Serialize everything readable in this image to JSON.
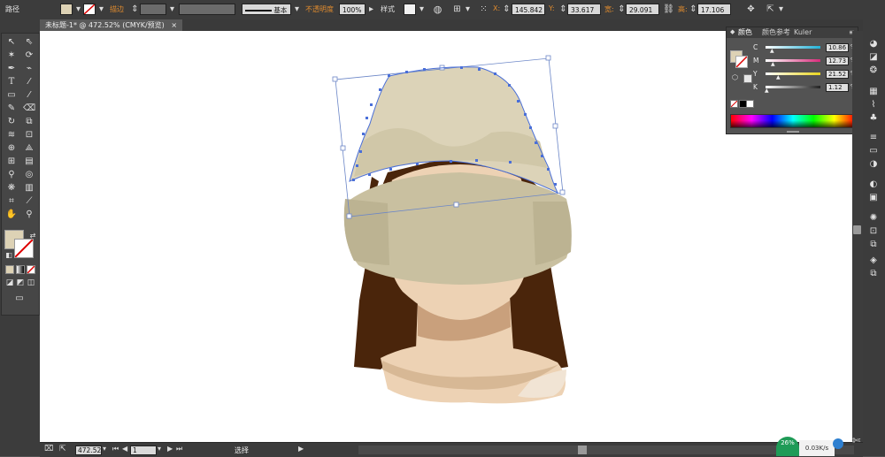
{
  "control_bar": {
    "object_type": "路径",
    "stroke_label": "描边",
    "stroke_profile": "基本",
    "opacity_label": "不透明度",
    "opacity_value": "100%",
    "style_label": "样式",
    "x_label": "X:",
    "x_value": "145.842",
    "y_label": "Y:",
    "y_value": "33.617",
    "w_label": "宽:",
    "w_value": "29.091",
    "h_label": "高:",
    "h_value": "17.106",
    "fill_color": "#ddd2b5"
  },
  "document_tab": {
    "title": "未标题-1* @ 472.52% (CMYK/预览)",
    "close": "×"
  },
  "color_panel": {
    "tabs": [
      "颜色",
      "颜色参考",
      "Kuler"
    ],
    "sliders": [
      {
        "channel": "C",
        "value": "10.86",
        "unit": "%",
        "level": 0.11,
        "color": "#22b1d7"
      },
      {
        "channel": "M",
        "value": "12.73",
        "unit": "%",
        "level": 0.13,
        "color": "#d82b7a"
      },
      {
        "channel": "Y",
        "value": "21.52",
        "unit": "%",
        "level": 0.22,
        "color": "#e9d51f"
      },
      {
        "channel": "K",
        "value": "1.12",
        "unit": "%",
        "level": 0.01,
        "color": "#222222"
      }
    ]
  },
  "status_bar": {
    "zoom": "472.52",
    "page": "1",
    "tool_status": "选择"
  },
  "network_badge": {
    "percent": "26%",
    "speed": "0.03K/s"
  },
  "colors": {
    "hat": "#dcd3b8",
    "hat_shadow": "#c9c0a0",
    "hair": "#4a250b",
    "skin": "#edd2b4",
    "skin_shadow": "#c9a07c",
    "selection": "#4a6fd8"
  }
}
